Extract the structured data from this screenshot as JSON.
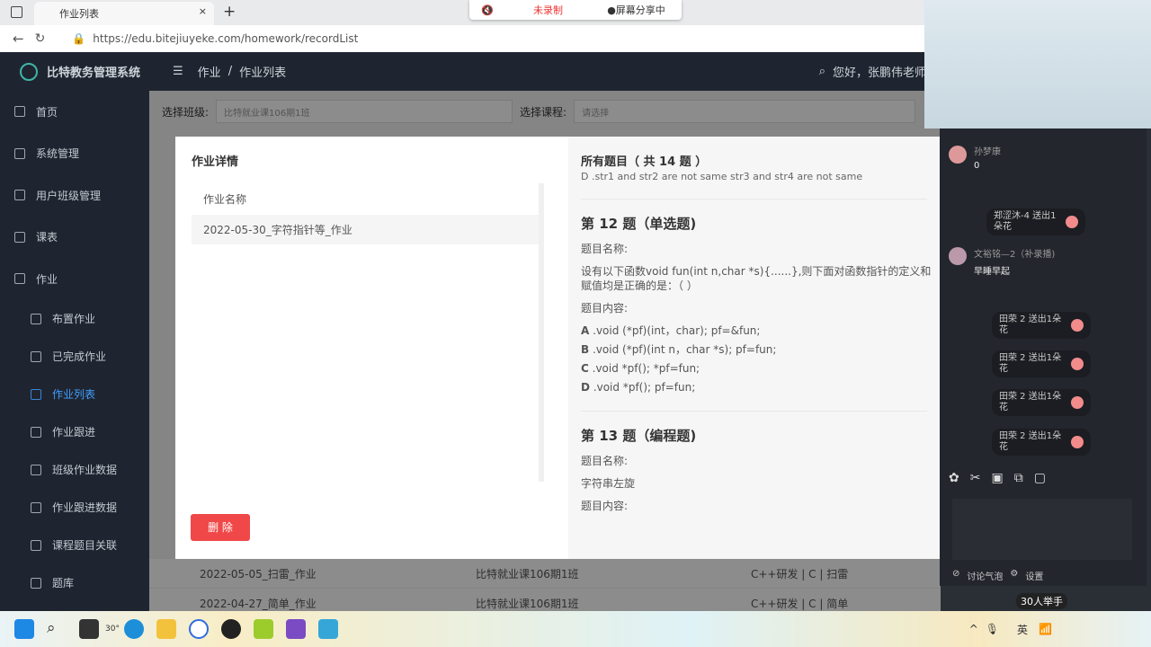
{
  "browser": {
    "tab_title": "作业列表",
    "url": "https://edu.bitejiuyeke.com/homework/recordList",
    "rec_status": "未录制",
    "share_status": "●屏幕分享中"
  },
  "header": {
    "app_name": "比特教务管理系统",
    "breadcrumb": [
      "作业",
      "作业列表"
    ],
    "greeting": "您好，张鹏伟老师"
  },
  "sidebar": {
    "items": [
      "首页",
      "系统管理",
      "用户班级管理",
      "课表",
      "作业"
    ],
    "sub_items": [
      "布置作业",
      "已完成作业",
      "作业列表",
      "作业跟进",
      "班级作业数据",
      "作业跟进数据",
      "课程题目关联",
      "题库"
    ],
    "active": "作业列表"
  },
  "filters": {
    "class_label": "选择班级:",
    "class_value": "比特就业课106期1班",
    "course_label": "选择课程:",
    "course_placeholder": "请选择"
  },
  "table_rows": [
    [
      "2022-05-05_扫雷_作业",
      "比特就业课106期1班",
      "C++研发 | C | 扫雷"
    ],
    [
      "2022-04-27_简单_作业",
      "比特就业课106期1班",
      "C++研发 | C | 简单"
    ]
  ],
  "modal": {
    "title": "作业详情",
    "name_header": "作业名称",
    "name_value": "2022-05-30_字符指针等_作业",
    "delete_label": "删 除",
    "all_title": "所有题目（ 共 14 题 ）",
    "prev_option": "D .str1 and str2 are not same str3 and str4 are not same",
    "q12": {
      "heading": "第 12 题（单选题)",
      "name_label": "题目名称:",
      "name": "设有以下函数void fun(int n,char *s){......},则下面对函数指针的定义和赋值均是正确的是：（ ）",
      "content_label": "题目内容:",
      "options": [
        [
          "A",
          ".void (*pf)(int，char); pf=&fun;"
        ],
        [
          "B",
          ".void (*pf)(int n，char *s); pf=fun;"
        ],
        [
          "C",
          ".void *pf(); *pf=fun;"
        ],
        [
          "D",
          ".void *pf(); pf=fun;"
        ]
      ]
    },
    "q13": {
      "heading": "第 13 题（编程题)",
      "name_label": "题目名称:",
      "name": "字符串左旋",
      "content_label": "题目内容:"
    }
  },
  "chat": {
    "messages": [
      {
        "user": "孙梦康",
        "text": "0"
      },
      {
        "user": "文裕铭—2（补录播)",
        "text": "早睡早起"
      }
    ],
    "gifts": [
      "郑涩沐-4 送出1朵花",
      "田荣 2 送出1朵花",
      "田荣 2 送出1朵花",
      "田荣 2 送出1朵花",
      "田荣 2 送出1朵花"
    ],
    "bubble_label": "讨论气泡",
    "settings_label": "设置",
    "raise_hands": "30人举手"
  },
  "taskbar": {
    "weather": "30°",
    "ime": "英"
  }
}
